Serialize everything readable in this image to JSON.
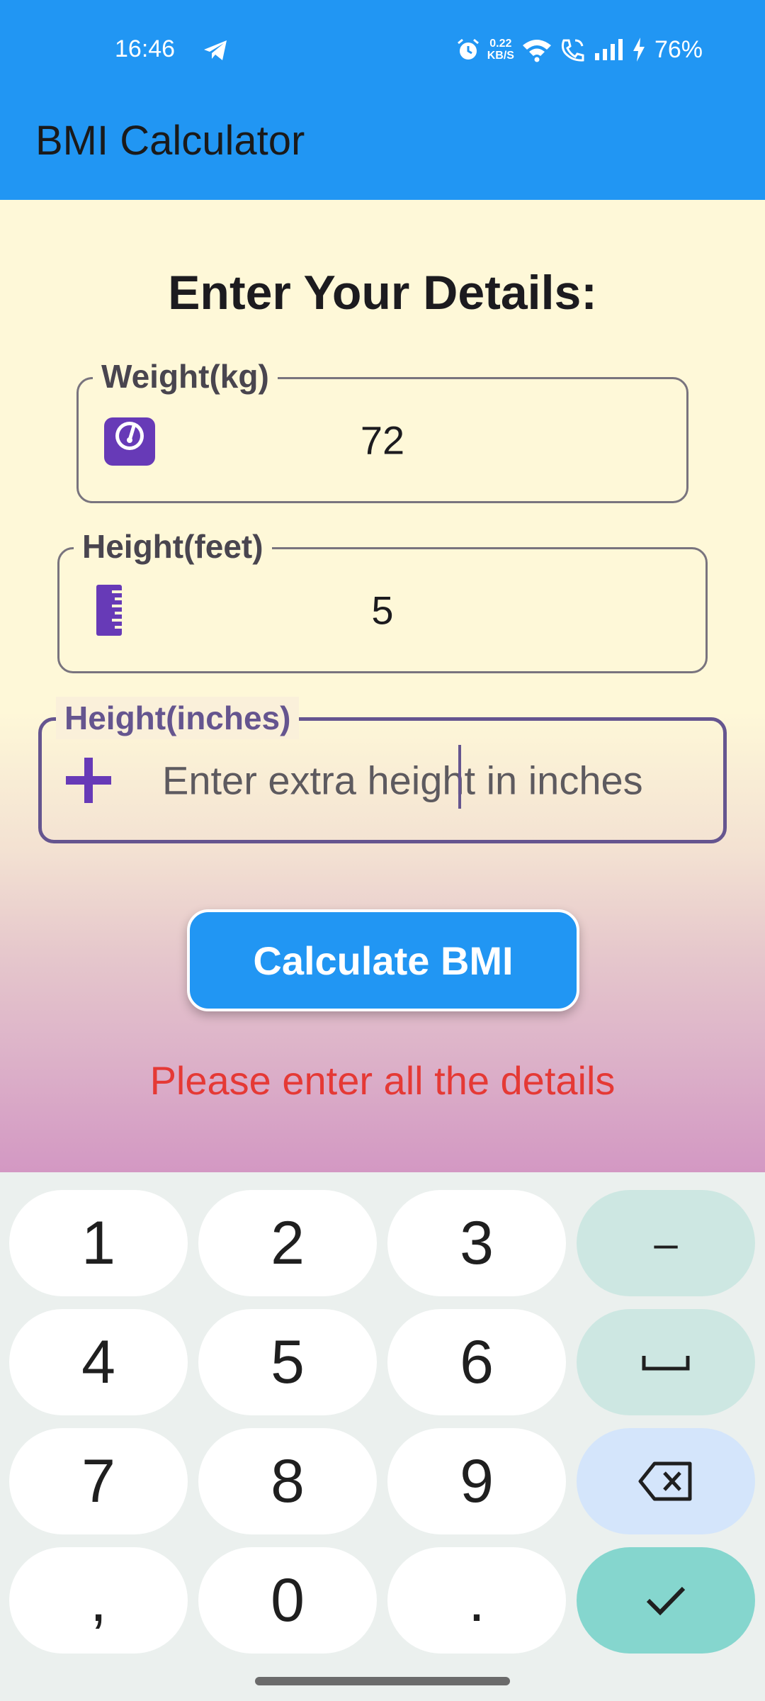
{
  "status_bar": {
    "time": "16:46",
    "net_speed_value": "0.22",
    "net_speed_unit": "KB/S",
    "battery": "76%",
    "icons": [
      "telegram-icon",
      "alarm-icon",
      "wifi-icon",
      "wifi-call-icon",
      "signal-icon",
      "charging-icon"
    ]
  },
  "app_bar": {
    "title": "BMI Calculator"
  },
  "form": {
    "heading": "Enter Your Details:",
    "weight": {
      "label": "Weight(kg)",
      "value": "72",
      "icon": "scale-icon"
    },
    "height_feet": {
      "label": "Height(feet)",
      "value": "5",
      "icon": "ruler-icon"
    },
    "height_inches": {
      "label": "Height(inches)",
      "placeholder": "Enter extra height in inches",
      "icon": "plus-icon"
    },
    "calculate_label": "Calculate BMI",
    "error": "Please enter all the details"
  },
  "keyboard": {
    "rows": [
      [
        "1",
        "2",
        "3",
        "–"
      ],
      [
        "4",
        "5",
        "6",
        "space"
      ],
      [
        "7",
        "8",
        "9",
        "backspace"
      ],
      [
        ",",
        "0",
        ".",
        "done"
      ]
    ]
  },
  "colors": {
    "app_bar": "#2196F3",
    "accent": "#65558F",
    "icon": "#673AB7",
    "error": "#E53935",
    "background": "#FEF8D8"
  }
}
